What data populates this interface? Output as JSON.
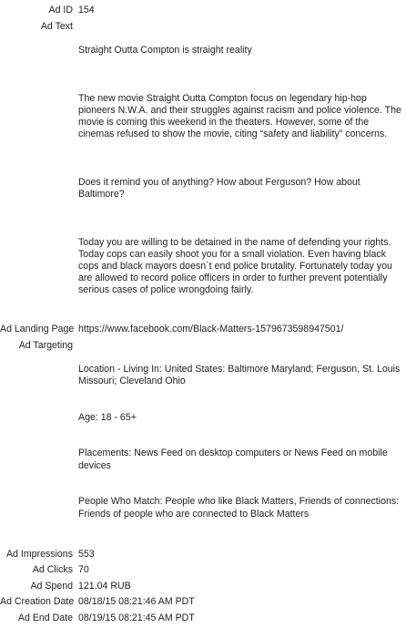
{
  "record": {
    "ad_id_label": "Ad ID",
    "ad_id": "154",
    "ad_text_label": "Ad Text",
    "ad_text_paragraphs": [
      "Straight Outta Compton is straight reality",
      "The new movie Straight Outta Compton focus on legendary hip-hop pioneers N.W.A. and their struggles against racism and police violence. The movie is coming this weekend in the theaters. However, some of the cinemas refused to show the movie, citing “safety and liability” concerns.",
      "Does it remind you of anything? How about Ferguson? How about Baltimore?",
      "Today you are willing to be detained in the name of defending your rights. Today cops can easily shoot you for a small violation. Even having black cops and black mayors doesn`t end police brutality. Fortunately today you are allowed to record police officers in order to further prevent potentially serious cases of police wrongdoing fairly."
    ],
    "landing_page_label": "Ad Landing Page",
    "landing_page": "https://www.facebook.com/Black-Matters-1579673598947501/",
    "targeting_label": "Ad Targeting",
    "targeting_location": "Location - Living In: United States: Baltimore Maryland; Ferguson, St. Louis Missouri; Cleveland Ohio",
    "targeting_age": "Age: 18 - 65+",
    "targeting_placements": "Placements: News Feed on desktop computers or News Feed on mobile devices",
    "targeting_people": "People Who Match: People who like Black Matters, Friends of connections: Friends of people who are connected to Black Matters",
    "impressions_label": "Ad Impressions",
    "impressions": "553",
    "clicks_label": "Ad Clicks",
    "clicks": "70",
    "spend_label": "Ad Spend",
    "spend": "121.04 RUB",
    "creation_label": "Ad Creation Date",
    "creation_date": "08/18/15 08:21:46 AM PDT",
    "end_label": "Ad End Date",
    "end_date": "08/19/15 08:21:45 AM PDT"
  }
}
